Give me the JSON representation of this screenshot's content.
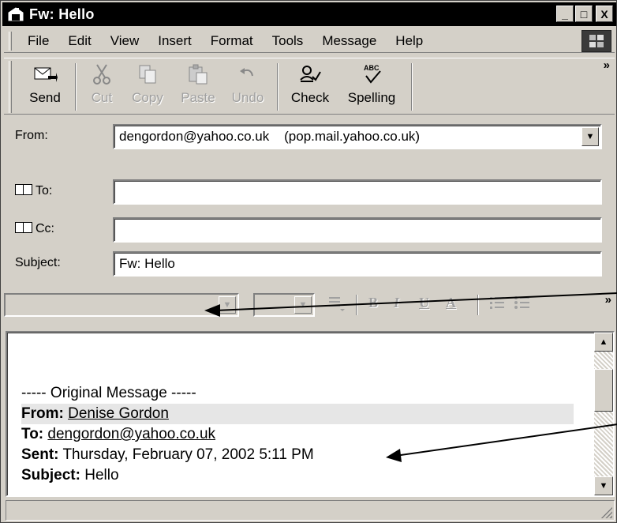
{
  "window": {
    "title": "Fw: Hello",
    "controls": {
      "minimize": "_",
      "maximize": "□",
      "close": "X"
    }
  },
  "menubar": {
    "items": [
      "File",
      "Edit",
      "View",
      "Insert",
      "Format",
      "Tools",
      "Message",
      "Help"
    ],
    "logo_icon": "windows-flag-icon"
  },
  "toolbar": {
    "buttons": [
      {
        "label": "Send",
        "icon": "send-icon",
        "enabled": true
      },
      {
        "label": "Cut",
        "icon": "scissors-icon",
        "enabled": false
      },
      {
        "label": "Copy",
        "icon": "copy-icon",
        "enabled": false
      },
      {
        "label": "Paste",
        "icon": "paste-icon",
        "enabled": false
      },
      {
        "label": "Undo",
        "icon": "undo-icon",
        "enabled": false
      },
      {
        "label": "Check",
        "icon": "check-names-icon",
        "enabled": true
      },
      {
        "label": "Spelling",
        "icon": "spelling-icon",
        "enabled": true
      }
    ],
    "overflow": "»"
  },
  "header": {
    "from_label": "From:",
    "from_value": "dengordon@yahoo.co.uk    (pop.mail.yahoo.co.uk)",
    "to_label": "To:",
    "to_value": "",
    "cc_label": "Cc:",
    "cc_value": "",
    "subject_label": "Subject:",
    "subject_value": "Fw: Hello"
  },
  "formatbar": {
    "overflow": "»",
    "bold": "B",
    "italic": "I",
    "underline": "U",
    "font_color": "A"
  },
  "message": {
    "original_header": "----- Original Message -----",
    "from_label": "From:",
    "from_value": "Denise Gordon",
    "to_label": "To:",
    "to_value": "dengordon@yahoo.co.uk",
    "sent_label": "Sent:",
    "sent_value": "Thursday, February 07, 2002 5:11 PM",
    "subject_label": "Subject:",
    "subject_value": "Hello"
  },
  "colors": {
    "chrome": "#d4d0c8",
    "titlebar": "#000000",
    "highlight_row": "#e6e6e6"
  }
}
